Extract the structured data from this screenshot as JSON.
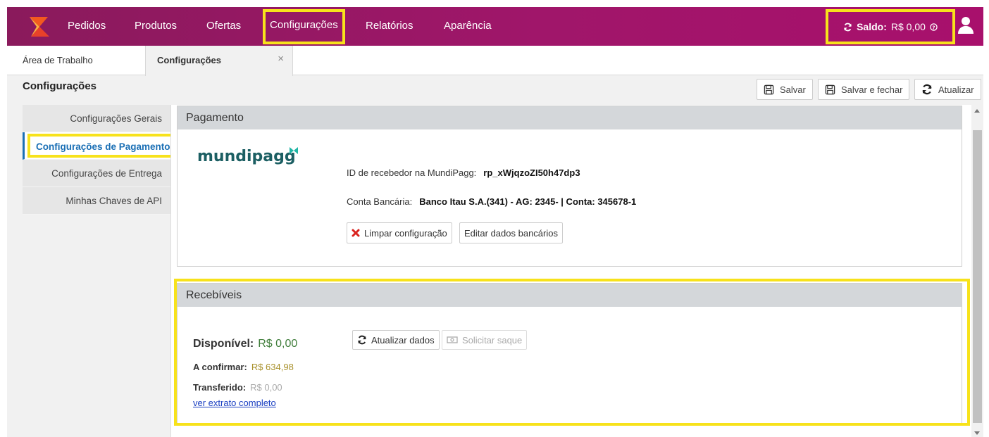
{
  "nav": {
    "items": [
      "Pedidos",
      "Produtos",
      "Ofertas",
      "Configurações",
      "Relatórios",
      "Aparência"
    ],
    "saldo_label": "Saldo:",
    "saldo_value": "R$ 0,00"
  },
  "tabs": {
    "area": "Área de Trabalho",
    "config": "Configurações",
    "close": "×"
  },
  "page": {
    "title": "Configurações",
    "save": "Salvar",
    "save_close": "Salvar e fechar",
    "refresh": "Atualizar"
  },
  "sidebar": {
    "items": [
      "Configurações Gerais",
      "Configurações de Pagamento",
      "Configurações de Entrega",
      "Minhas Chaves de API"
    ]
  },
  "payment": {
    "header": "Pagamento",
    "logo_text": "mundipagg",
    "receiver_label": "ID de recebedor na MundiPagg:",
    "receiver_value": "rp_xWjqzoZI50h47dp3",
    "bank_label": "Conta Bancária:",
    "bank_value": "Banco Itau S.A.(341) - AG: 2345- | Conta: 345678-1",
    "clear_btn": "Limpar configuração",
    "edit_btn": "Editar dados bancários"
  },
  "receivables": {
    "header": "Recebíveis",
    "available_label": "Disponível:",
    "available_value": "R$ 0,00",
    "confirm_label": "A confirmar:",
    "confirm_value": "R$ 634,98",
    "transferred_label": "Transferido:",
    "transferred_value": "R$ 0,00",
    "statement_link": "ver extrato completo",
    "update_btn": "Atualizar dados",
    "withdraw_btn": "Solicitar saque"
  },
  "colors": {
    "nav_bg": "#a0166a",
    "highlight": "#f7e21b",
    "active_link": "#1a6fb5",
    "available_green": "#3f7d3a",
    "confirm_gold": "#a8902a"
  }
}
